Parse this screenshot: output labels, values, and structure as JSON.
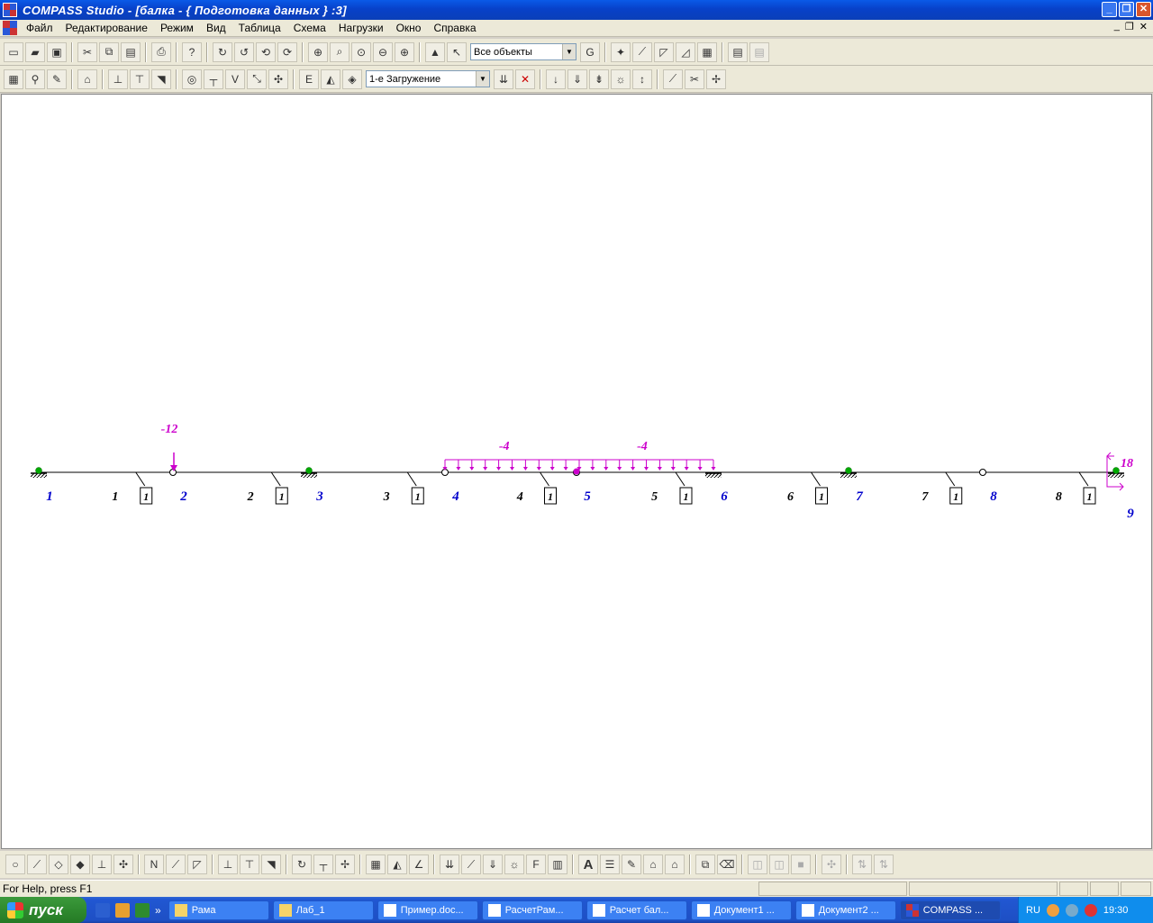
{
  "window": {
    "title": "COMPASS  Studio - [балка - { Подготовка данных } :3]"
  },
  "menu": [
    "Файл",
    "Редактирование",
    "Режим",
    "Вид",
    "Таблица",
    "Схема",
    "Нагрузки",
    "Окно",
    "Справка"
  ],
  "toolbar": {
    "filter_select": "Все объекты",
    "load_case_select": "1-е Загружение"
  },
  "scheme": {
    "nodes": [
      "1",
      "2",
      "3",
      "4",
      "5",
      "6",
      "7",
      "8",
      "9"
    ],
    "elements": [
      "1",
      "2",
      "3",
      "4",
      "5",
      "6",
      "7",
      "8"
    ],
    "element_type": "1",
    "point_load": "-12",
    "distributed_load_1": "-4",
    "distributed_load_2": "-4",
    "moment": "18",
    "colors": {
      "nodes": "#0000cc",
      "loads": "#cc00cc",
      "supports": "#00aa00"
    }
  },
  "status": {
    "message": "For Help, press F1"
  },
  "taskbar": {
    "start": "пуск",
    "tasks": [
      "Рама",
      "Лаб_1",
      "Пример.doc...",
      "РасчетРам...",
      "Расчет бал...",
      "Документ1 ...",
      "Документ2 ...",
      "COMPASS ..."
    ],
    "lang": "RU",
    "clock": "19:30"
  }
}
